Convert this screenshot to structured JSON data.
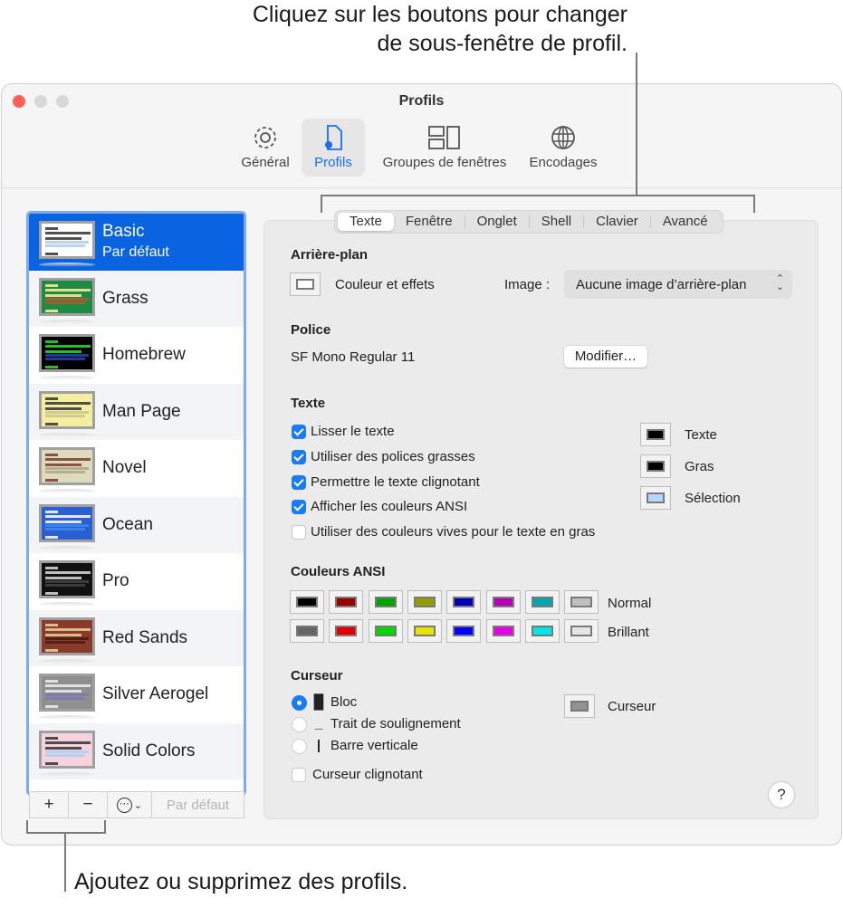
{
  "callouts": {
    "top_line1": "Cliquez sur les boutons pour changer",
    "top_line2": "de sous-fenêtre de profil.",
    "bottom": "Ajoutez ou supprimez des profils."
  },
  "window": {
    "title": "Profils",
    "toolbar": [
      {
        "label": "Général",
        "icon": "gear-icon"
      },
      {
        "label": "Profils",
        "icon": "profile-document-icon",
        "active": true
      },
      {
        "label": "Groupes de fenêtres",
        "icon": "window-groups-icon"
      },
      {
        "label": "Encodages",
        "icon": "globe-icon"
      }
    ]
  },
  "profiles": {
    "items": [
      {
        "name": "Basic",
        "subtitle": "Par défaut",
        "selected": true,
        "bg": "#ffffff",
        "fg": "#333333",
        "hl": "#aaccee"
      },
      {
        "name": "Grass",
        "bg": "#1f8a44",
        "fg": "#ffee99",
        "hl": "#c0532b"
      },
      {
        "name": "Homebrew",
        "bg": "#000000",
        "fg": "#33dd33",
        "hl": "#2244bb"
      },
      {
        "name": "Man Page",
        "bg": "#f3eea0",
        "fg": "#333333",
        "hl": "#c9c38a"
      },
      {
        "name": "Novel",
        "bg": "#dedabe",
        "fg": "#7a3b2e",
        "hl": "#aaa88a"
      },
      {
        "name": "Ocean",
        "bg": "#2a5fd0",
        "fg": "#ffffff",
        "hl": "#3a8cf0"
      },
      {
        "name": "Pro",
        "bg": "#111111",
        "fg": "#dddddd",
        "hl": "#444444"
      },
      {
        "name": "Red Sands",
        "bg": "#8a3a2a",
        "fg": "#e8d39a",
        "hl": "#4a1a14"
      },
      {
        "name": "Silver Aerogel",
        "bg": "#8f8f8f",
        "fg": "#eeeeee",
        "hl": "#7a7ab0"
      },
      {
        "name": "Solid Colors",
        "bg": "#f5d2dc",
        "fg": "#333333",
        "hl": "#aad0f5"
      }
    ],
    "buttons": {
      "add": "+",
      "remove": "−",
      "more": "⋯",
      "default": "Par défaut"
    }
  },
  "tabs": [
    {
      "label": "Texte",
      "active": true
    },
    {
      "label": "Fenêtre"
    },
    {
      "label": "Onglet"
    },
    {
      "label": "Shell"
    },
    {
      "label": "Clavier"
    },
    {
      "label": "Avancé"
    }
  ],
  "background": {
    "heading": "Arrière-plan",
    "color_label": "Couleur et effets",
    "image_label": "Image :",
    "image_value": "Aucune image d’arrière-plan"
  },
  "font": {
    "heading": "Police",
    "value": "SF Mono Regular 11",
    "modify_button": "Modifier…"
  },
  "text": {
    "heading": "Texte",
    "options": [
      {
        "label": "Lisser le texte",
        "checked": true
      },
      {
        "label": "Utiliser des polices grasses",
        "checked": true
      },
      {
        "label": "Permettre le texte clignotant",
        "checked": true
      },
      {
        "label": "Afficher les couleurs ANSI",
        "checked": true
      },
      {
        "label": "Utiliser des couleurs vives pour le texte en gras",
        "checked": false
      }
    ],
    "colors": [
      {
        "label": "Texte",
        "color": "#000000"
      },
      {
        "label": "Gras",
        "color": "#000000"
      },
      {
        "label": "Sélection",
        "color": "#b3d7ff"
      }
    ]
  },
  "ansi": {
    "heading": "Couleurs ANSI",
    "normal_label": "Normal",
    "bright_label": "Brillant",
    "normal": [
      "#000000",
      "#990000",
      "#00a600",
      "#999900",
      "#0000b2",
      "#b200b2",
      "#00a6b2",
      "#bfbfbf"
    ],
    "bright": [
      "#666666",
      "#e50000",
      "#00d900",
      "#e5e500",
      "#0000ff",
      "#e500e5",
      "#00e5e5",
      "#e5e5e5"
    ]
  },
  "cursor": {
    "heading": "Curseur",
    "options": [
      {
        "label": "Bloc",
        "glyph": "█",
        "selected": true
      },
      {
        "label": "Trait de soulignement",
        "glyph": "_",
        "selected": false
      },
      {
        "label": "Barre verticale",
        "glyph": "|",
        "selected": false
      }
    ],
    "blink_label": "Curseur clignotant",
    "blink_checked": false,
    "color_label": "Curseur",
    "color": "#929292"
  },
  "help_label": "?"
}
